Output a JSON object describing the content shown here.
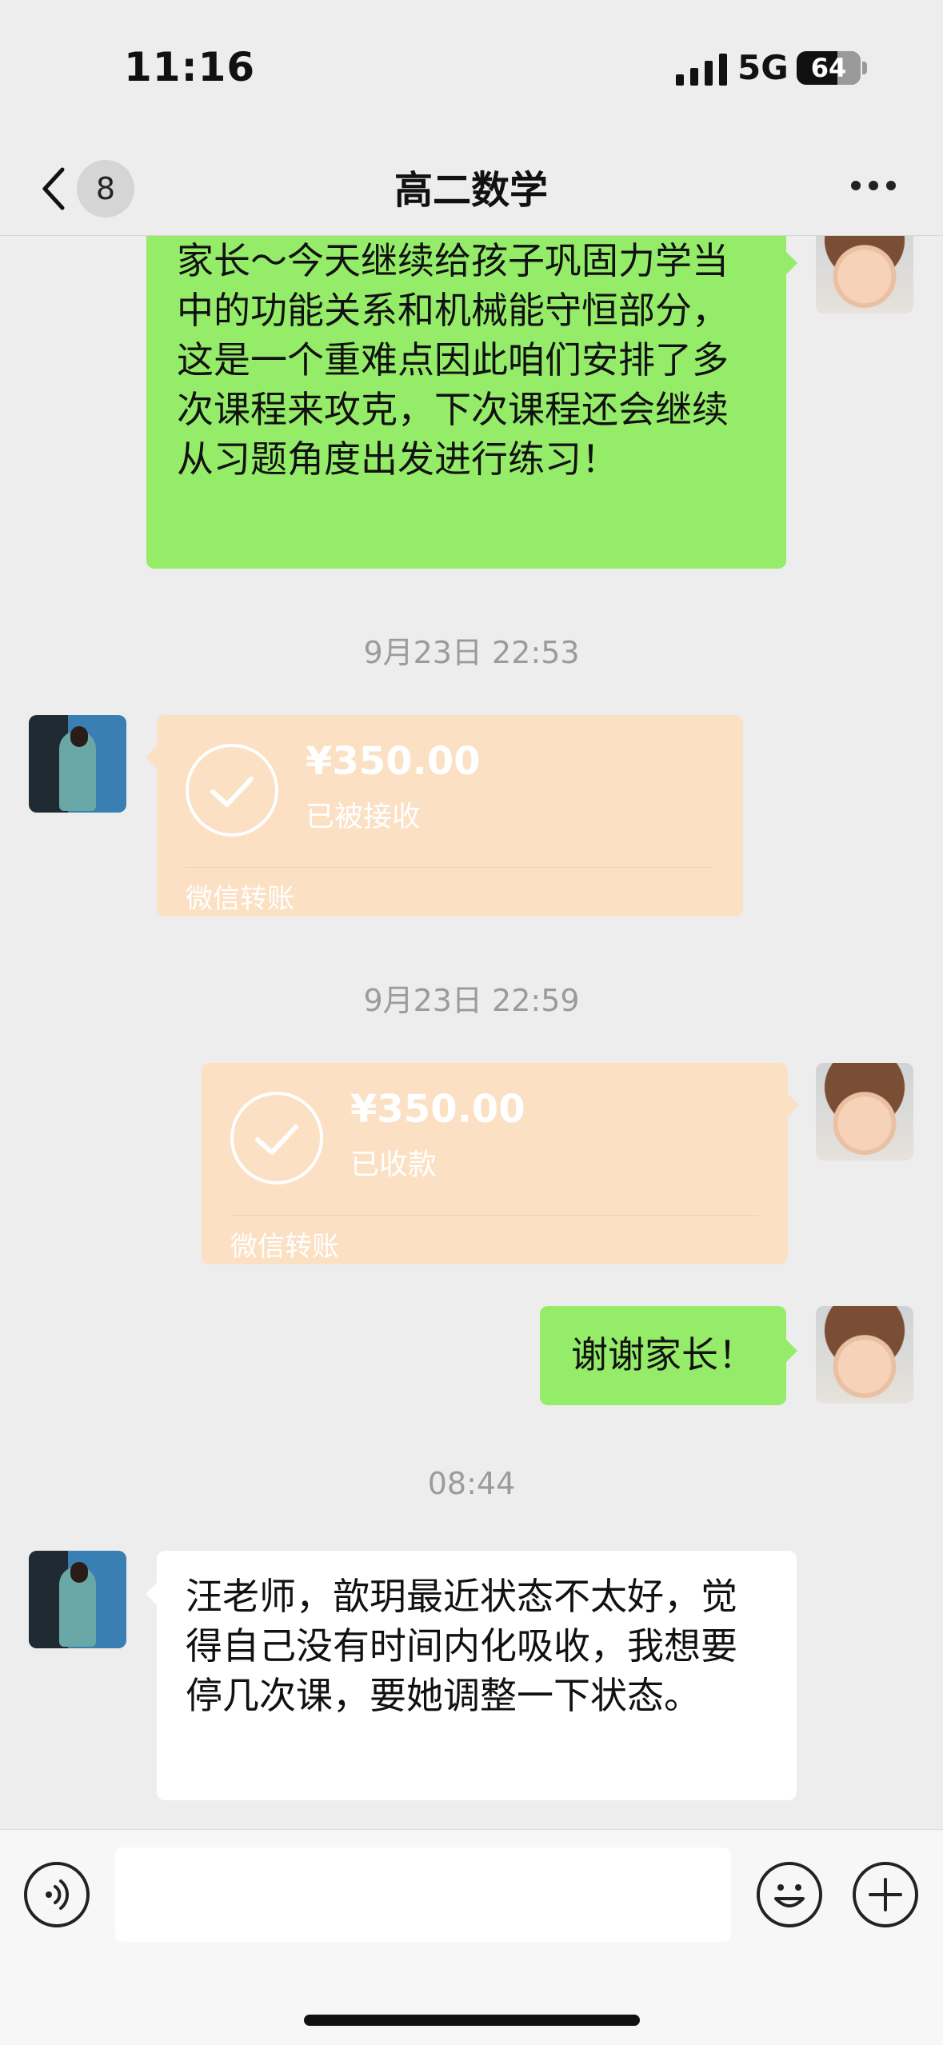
{
  "status_bar": {
    "time": "11:16",
    "network": "5G",
    "battery": "64",
    "battery_level": 0.64
  },
  "nav": {
    "unread_count": "8",
    "title": "高二数学",
    "back_icon": "chevron-left-icon",
    "more_icon": "ellipsis-icon"
  },
  "messages": {
    "m1_text": "家长～今天继续给孩子巩固力学当中的功能关系和机械能守恒部分，这是一个重难点因此咱们安排了多次课程来攻克，下次课程还会继续从习题角度出发进行练习！",
    "ts1": "9月23日 22:53",
    "t1": {
      "amount": "¥350.00",
      "status": "已被接收",
      "label": "微信转账"
    },
    "ts2": "9月23日 22:59",
    "t2": {
      "amount": "¥350.00",
      "status": "已收款",
      "label": "微信转账"
    },
    "m2_text": "谢谢家长！",
    "ts3": "08:44",
    "m3_text": "汪老师，歆玥最近状态不太好，觉得自己没有时间内化吸收，我想要停几次课，要她调整一下状态。"
  },
  "input": {
    "placeholder": ""
  },
  "colors": {
    "background": "#ededed",
    "green_bubble": "#95ec69",
    "transfer": "#fbe0c4"
  }
}
